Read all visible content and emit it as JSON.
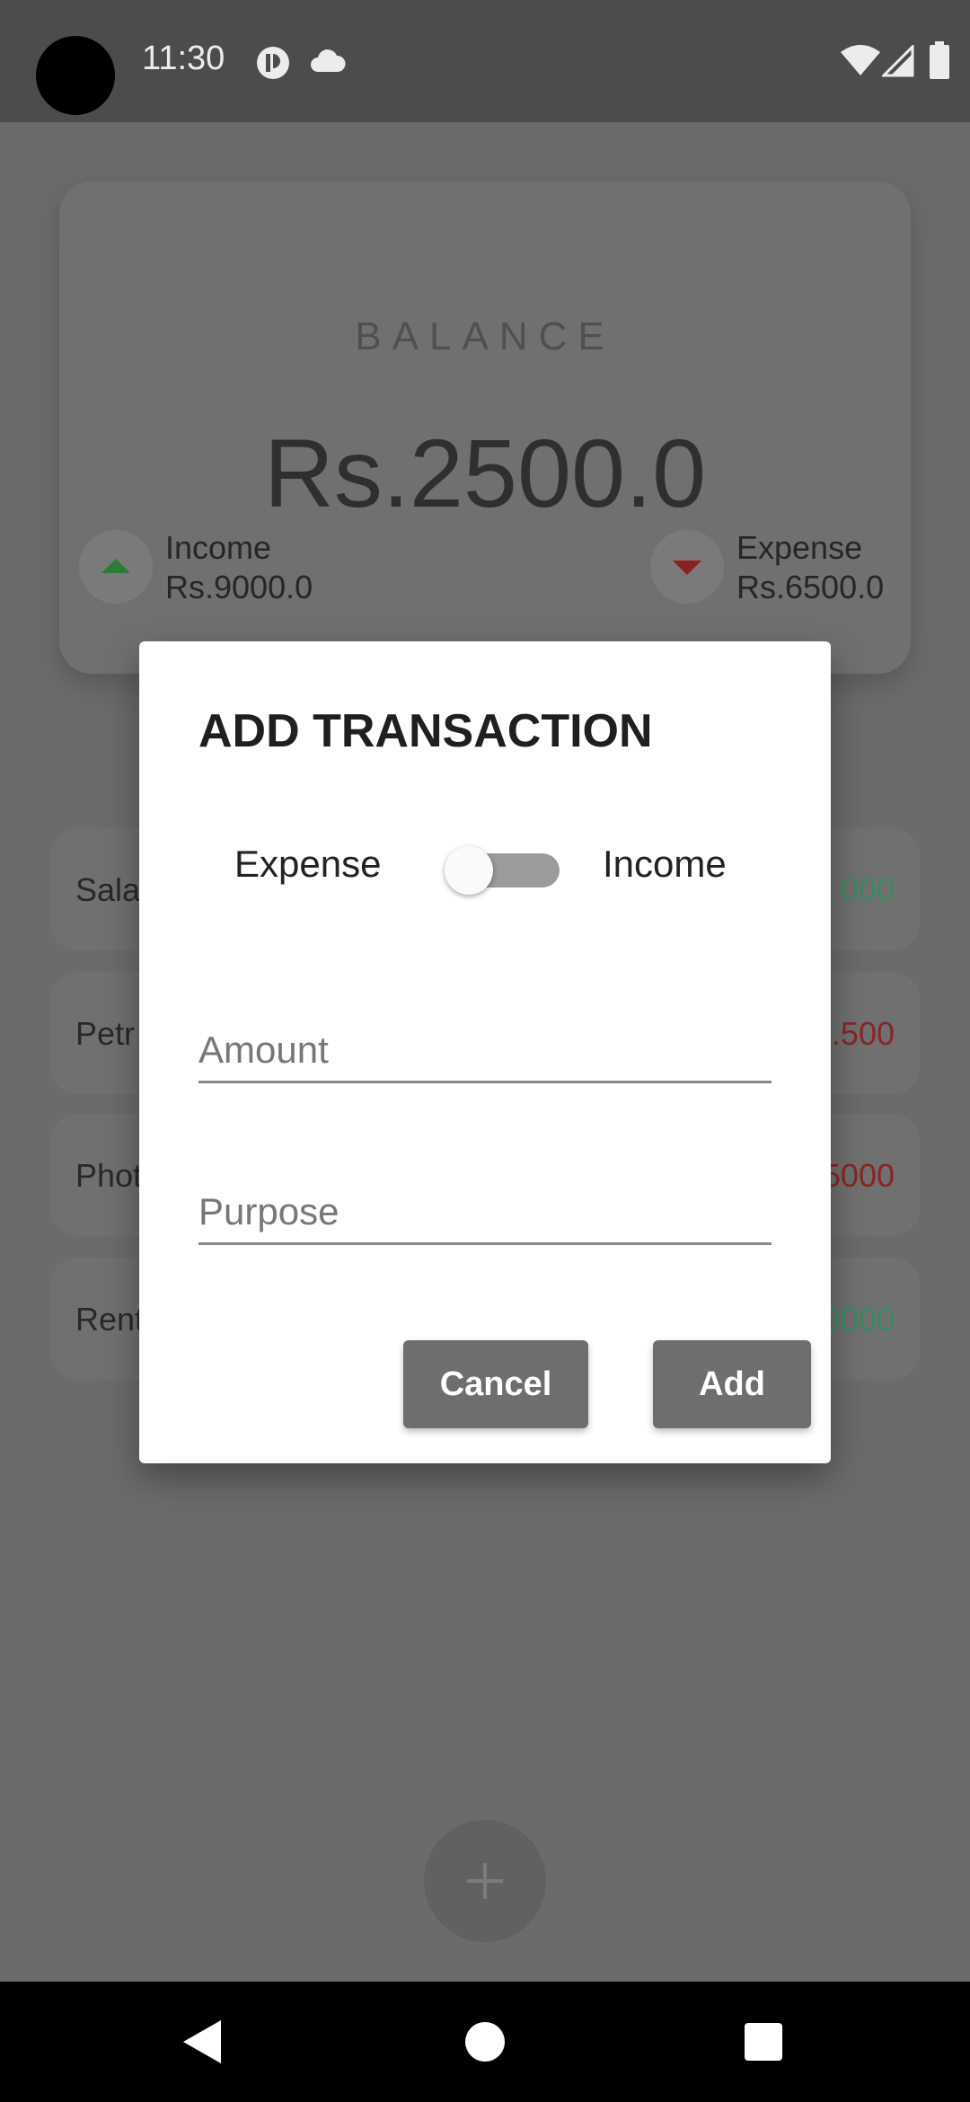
{
  "status_bar": {
    "time": "11:30"
  },
  "balance_card": {
    "title": "BALANCE",
    "amount": "Rs.2500.0",
    "income_label": "Income",
    "income_value": "Rs.9000.0",
    "expense_label": "Expense",
    "expense_value": "Rs.6500.0"
  },
  "transactions": [
    {
      "name": "Sala",
      "amount": "000",
      "color": "#3a8a62"
    },
    {
      "name": "Petr",
      "amount": ".500",
      "color": "#8b2525"
    },
    {
      "name": "Phot",
      "amount": "5000",
      "color": "#8b2525"
    },
    {
      "name": "Rent",
      "amount": "8000",
      "color": "#3a8a62"
    }
  ],
  "dialog": {
    "title": "ADD TRANSACTION",
    "toggle_left_label": "Expense",
    "toggle_right_label": "Income",
    "toggle_state": "off",
    "amount_placeholder": "Amount",
    "amount_value": "",
    "purpose_placeholder": "Purpose",
    "purpose_value": "",
    "cancel_label": "Cancel",
    "add_label": "Add"
  },
  "fab": {
    "icon": "plus-icon"
  },
  "colors": {
    "income_arrow": "#2f7a36",
    "expense_arrow": "#8b2020",
    "button": "#6e6e6e"
  }
}
